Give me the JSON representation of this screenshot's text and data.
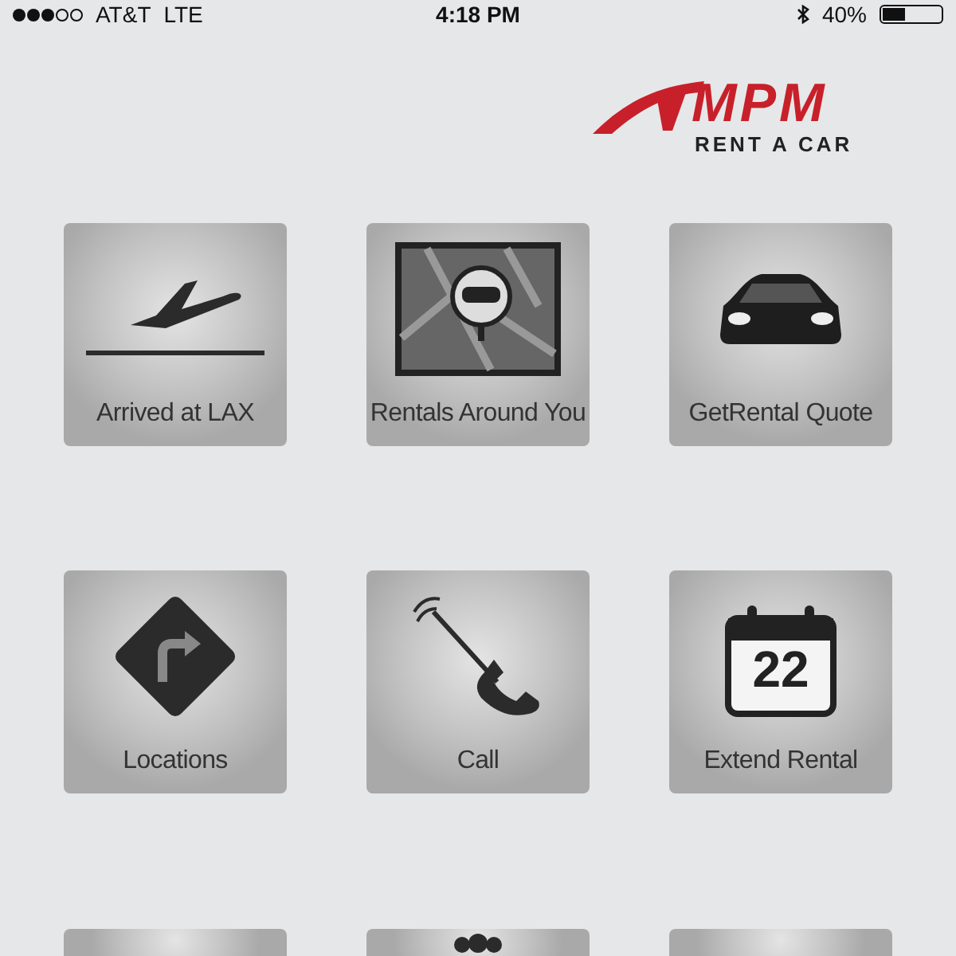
{
  "status_bar": {
    "carrier": "AT&T",
    "network": "LTE",
    "time": "4:18 PM",
    "battery": "40%"
  },
  "logo": {
    "brand": "MPM",
    "tagline": "RENT A CAR"
  },
  "tiles": [
    {
      "kind": "full",
      "label": "Arrived at LAX"
    },
    {
      "kind": "full",
      "label": "Rentals Around You"
    },
    {
      "kind": "full",
      "label": "GetRental Quote"
    },
    {
      "kind": "full",
      "label": "Locations"
    },
    {
      "kind": "full",
      "label": "Call"
    },
    {
      "kind": "full",
      "label": "Extend Rental",
      "badge": "22"
    },
    {
      "kind": "cut"
    },
    {
      "kind": "cut"
    },
    {
      "kind": "cut"
    }
  ]
}
